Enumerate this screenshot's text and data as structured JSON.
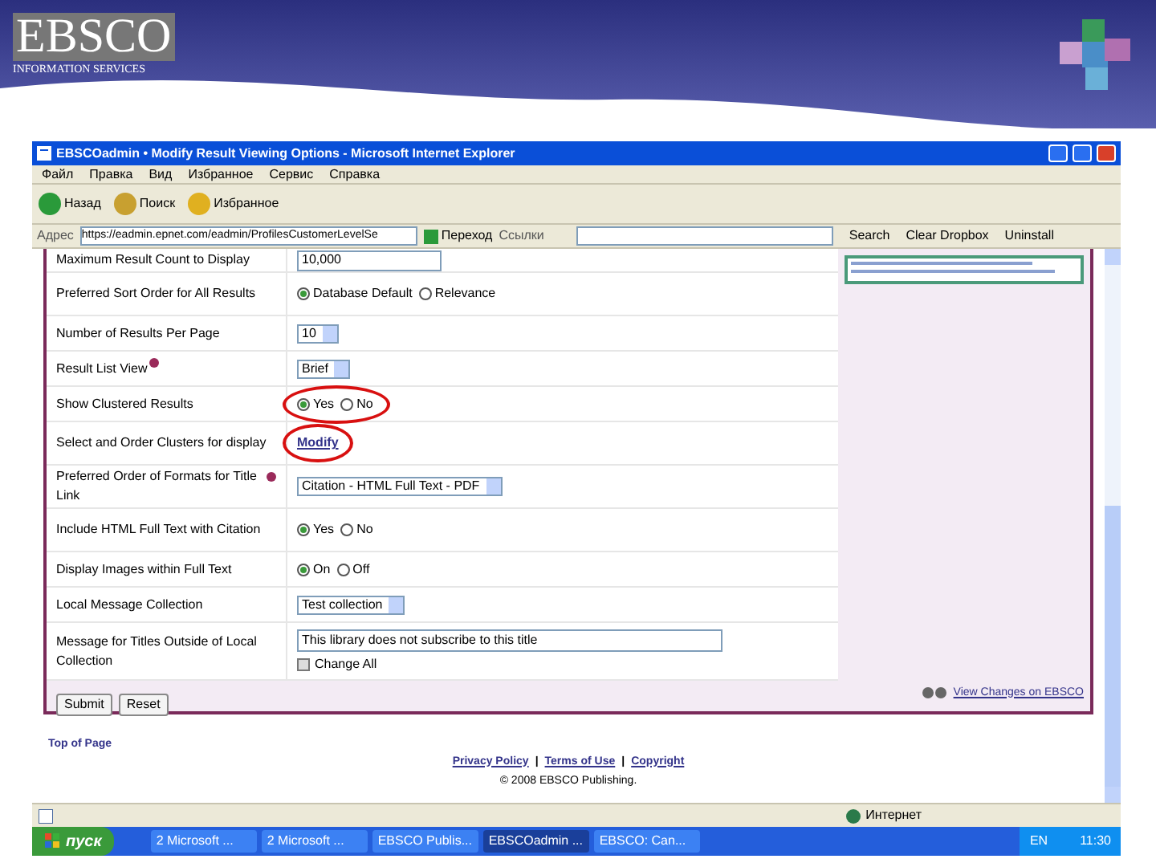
{
  "slide": {
    "logo": {
      "title": "EBSCO",
      "subtitle": "INFORMATION SERVICES"
    }
  },
  "browser": {
    "title": "EBSCOadmin • Modify Result Viewing Options - Microsoft Internet Explorer",
    "menu": [
      "Файл",
      "Правка",
      "Вид",
      "Избранное",
      "Сервис",
      "Справка"
    ],
    "toolbar": [
      {
        "label": "Назад"
      },
      {
        "label": "Поиск"
      },
      {
        "label": "Избранное"
      }
    ],
    "address": {
      "label": "Адрес",
      "url": "https://eadmin.epnet.com/eadmin/ProfilesCustomerLevelSe",
      "go": "Переход",
      "links": "Ссылки"
    },
    "search_bar": [
      "Search",
      "Clear Dropbox",
      "Uninstall"
    ],
    "status": "Интернет"
  },
  "settings": [
    {
      "kind": "text",
      "label": "Maximum Result Count to Display",
      "value": "10,000",
      "help": false,
      "annotated": false
    },
    {
      "kind": "radio",
      "label": "Preferred Sort Order for All Results",
      "options": [
        {
          "label": "Database Default",
          "selected": true
        },
        {
          "label": "Relevance",
          "selected": false
        }
      ],
      "help": false,
      "annotated": false
    },
    {
      "kind": "select",
      "label": "Number of Results Per Page",
      "value": "10",
      "help": false,
      "annotated": false
    },
    {
      "kind": "select",
      "label": "Result List View",
      "value": "Brief",
      "help": true,
      "annotated": false
    },
    {
      "kind": "radio",
      "label": "Show Clustered Results",
      "options": [
        {
          "label": "Yes",
          "selected": true
        },
        {
          "label": "No",
          "selected": false
        }
      ],
      "help": false,
      "annotated": true
    },
    {
      "kind": "link",
      "label": "Select and Order Clusters for display",
      "value": "Modify",
      "help": false,
      "annotated": true
    },
    {
      "kind": "select",
      "label": "Preferred Order of Formats for Title Link",
      "value": "Citation - HTML Full Text - PDF",
      "help": true,
      "annotated": false
    },
    {
      "kind": "radio",
      "label": "Include HTML Full Text with Citation",
      "options": [
        {
          "label": "Yes",
          "selected": true
        },
        {
          "label": "No",
          "selected": false
        }
      ],
      "help": false,
      "annotated": false
    },
    {
      "kind": "radio",
      "label": "Display Images within Full Text",
      "options": [
        {
          "label": "On",
          "selected": true
        },
        {
          "label": "Off",
          "selected": false
        }
      ],
      "help": false,
      "annotated": false
    },
    {
      "kind": "select",
      "label": "Local Message Collection",
      "value": "Test collection",
      "help": false,
      "annotated": false
    },
    {
      "kind": "text_check",
      "label": "Message for Titles Outside of Local Collection",
      "value": "This library does not subscribe to this title",
      "check_label": "Change All",
      "checked": false,
      "help": false,
      "annotated": false
    }
  ],
  "buttons": [
    "Submit",
    "Reset"
  ],
  "view_link": "View Changes on EBSCO",
  "top_link": "Top of Page",
  "footer_links": [
    "Privacy Policy",
    "Terms of Use",
    "Copyright"
  ],
  "footer_separator": "|",
  "copyright": "© 2008 EBSCO Publishing.",
  "taskbar": {
    "start": "пуск",
    "tasks": [
      {
        "label": "2 Microsoft ...",
        "selected": false
      },
      {
        "label": "2 Microsoft ...",
        "selected": false
      },
      {
        "label": "EBSCO Publis...",
        "selected": false
      },
      {
        "label": "EBSCOadmin ...",
        "selected": true
      },
      {
        "label": "EBSCO: Can...",
        "selected": false
      }
    ],
    "lang": "EN",
    "clock": "11:30"
  }
}
